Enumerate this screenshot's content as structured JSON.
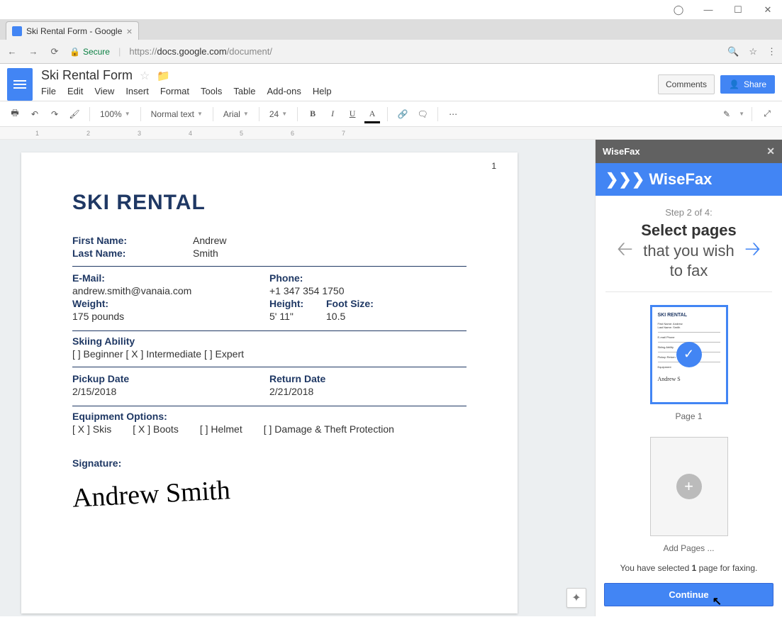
{
  "browser": {
    "tab_title": "Ski Rental Form - Google",
    "secure_label": "Secure",
    "url_display": "https://docs.google.com/document/"
  },
  "docs": {
    "title": "Ski Rental Form",
    "menus": [
      "File",
      "Edit",
      "View",
      "Insert",
      "Format",
      "Tools",
      "Table",
      "Add-ons",
      "Help"
    ],
    "comments_btn": "Comments",
    "share_btn": "Share",
    "toolbar": {
      "zoom": "100%",
      "style": "Normal text",
      "font": "Arial",
      "size": "24"
    },
    "page_number": "1"
  },
  "form": {
    "heading": "SKI RENTAL",
    "first_name_label": "First Name:",
    "first_name": "Andrew",
    "last_name_label": "Last Name:",
    "last_name": "Smith",
    "email_label": "E-Mail:",
    "email": "andrew.smith@vanaia.com",
    "phone_label": "Phone:",
    "phone": "+1 347 354 1750",
    "weight_label": "Weight:",
    "weight": "175 pounds",
    "height_label": "Height:",
    "height": "5' 11\"",
    "foot_label": "Foot Size:",
    "foot": "10.5",
    "skiing_ability_label": "Skiing Ability",
    "ability_line": "[   ]  Beginner     [ X ]  Intermediate     [   ]  Expert",
    "pickup_label": "Pickup Date",
    "pickup": "2/15/2018",
    "return_label": "Return Date",
    "return": "2/21/2018",
    "equip_label": "Equipment Options:",
    "equip": {
      "skis": "[ X ]   Skis",
      "boots": "[ X ]   Boots",
      "helmet": "[    ]   Helmet",
      "dt": "[    ]   Damage & Theft Protection"
    },
    "signature_label": "Signature:",
    "signature": "Andrew Smith"
  },
  "sidebar": {
    "title": "WiseFax",
    "brand": "WiseFax",
    "step": "Step 2 of 4:",
    "msg_prefix": "Select pages",
    "msg_suffix": " that you wish to fax",
    "page1_label": "Page 1",
    "add_pages": "Add Pages ...",
    "selected_text_pre": "You have selected ",
    "selected_count": "1",
    "selected_text_post": " page for faxing.",
    "continue_btn": "Continue"
  }
}
